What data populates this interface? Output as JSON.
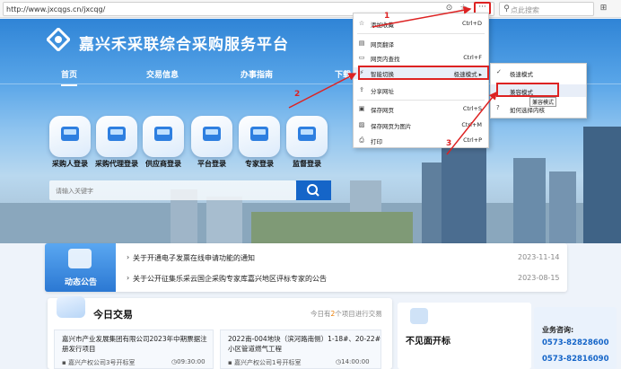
{
  "browser": {
    "url": "http://www.jxcqgs.cn/jxcqg/",
    "more_label": "···",
    "search_placeholder": "点此搜索"
  },
  "site": {
    "title": "嘉兴禾采联综合采购服务平台",
    "nav": [
      "首页",
      "交易信息",
      "办事指南",
      "下载"
    ],
    "services": [
      "采购人登录",
      "采购代理登录",
      "供应商登录",
      "平台登录",
      "专家登录",
      "监督登录"
    ],
    "search_placeholder": "请输入关键字"
  },
  "context_menu": {
    "items": [
      {
        "icon": "add-favorite-icon",
        "label": "添加收藏",
        "shortcut": "Ctrl+D"
      },
      {
        "icon": "translate-icon",
        "label": "网页翻译",
        "shortcut": ""
      },
      {
        "icon": "find-icon",
        "label": "网页内查找",
        "shortcut": "Ctrl+F"
      },
      {
        "icon": "switch-icon",
        "label": "智能切换",
        "shortcut": "极速模式 ▸"
      },
      {
        "icon": "share-icon",
        "label": "分享网址",
        "shortcut": ""
      },
      {
        "icon": "save-icon",
        "label": "保存网页",
        "shortcut": "Ctrl+S"
      },
      {
        "icon": "save-image-icon",
        "label": "保存网页为图片",
        "shortcut": "Ctrl+M"
      },
      {
        "icon": "print-icon",
        "label": "打印",
        "shortcut": "Ctrl+P"
      }
    ]
  },
  "submenu": {
    "items": [
      "极速模式",
      "兼容模式",
      "如何选择内核"
    ],
    "tooltip": "兼容模式"
  },
  "annotations": [
    "1",
    "2",
    "3"
  ],
  "announcements": {
    "badge": "动态公告",
    "items": [
      {
        "text": "关于开通电子发票在线申请功能的通知",
        "date": "2023-11-14"
      },
      {
        "text": "关于公开征集乐采云国企采购专家库嘉兴地区评标专家的公告",
        "date": "2023-08-15"
      }
    ]
  },
  "today_trade": {
    "title": "今日交易",
    "subtitle_prefix": "今日有",
    "count": "2",
    "subtitle_suffix": "个项目进行交易",
    "cards": [
      {
        "title": "嘉兴市产业发展集团有限公司2023年中期票据注册发行项目",
        "org": "嘉兴产权公司3号开标室",
        "time": "09:30:00"
      },
      {
        "title": "2022南-004地块（滨河路南侧）1-18#、20-22#小区管道燃气工程",
        "org": "嘉兴产权公司1号开标室",
        "time": "14:00:00"
      }
    ]
  },
  "right_panel": {
    "title": "不见面开标"
  },
  "contact": {
    "label": "业务咨询:",
    "phones": [
      "0573-82828600",
      "0573-82816090"
    ]
  },
  "colors": {
    "accent": "#1565c8",
    "annotation": "#dd2222"
  }
}
